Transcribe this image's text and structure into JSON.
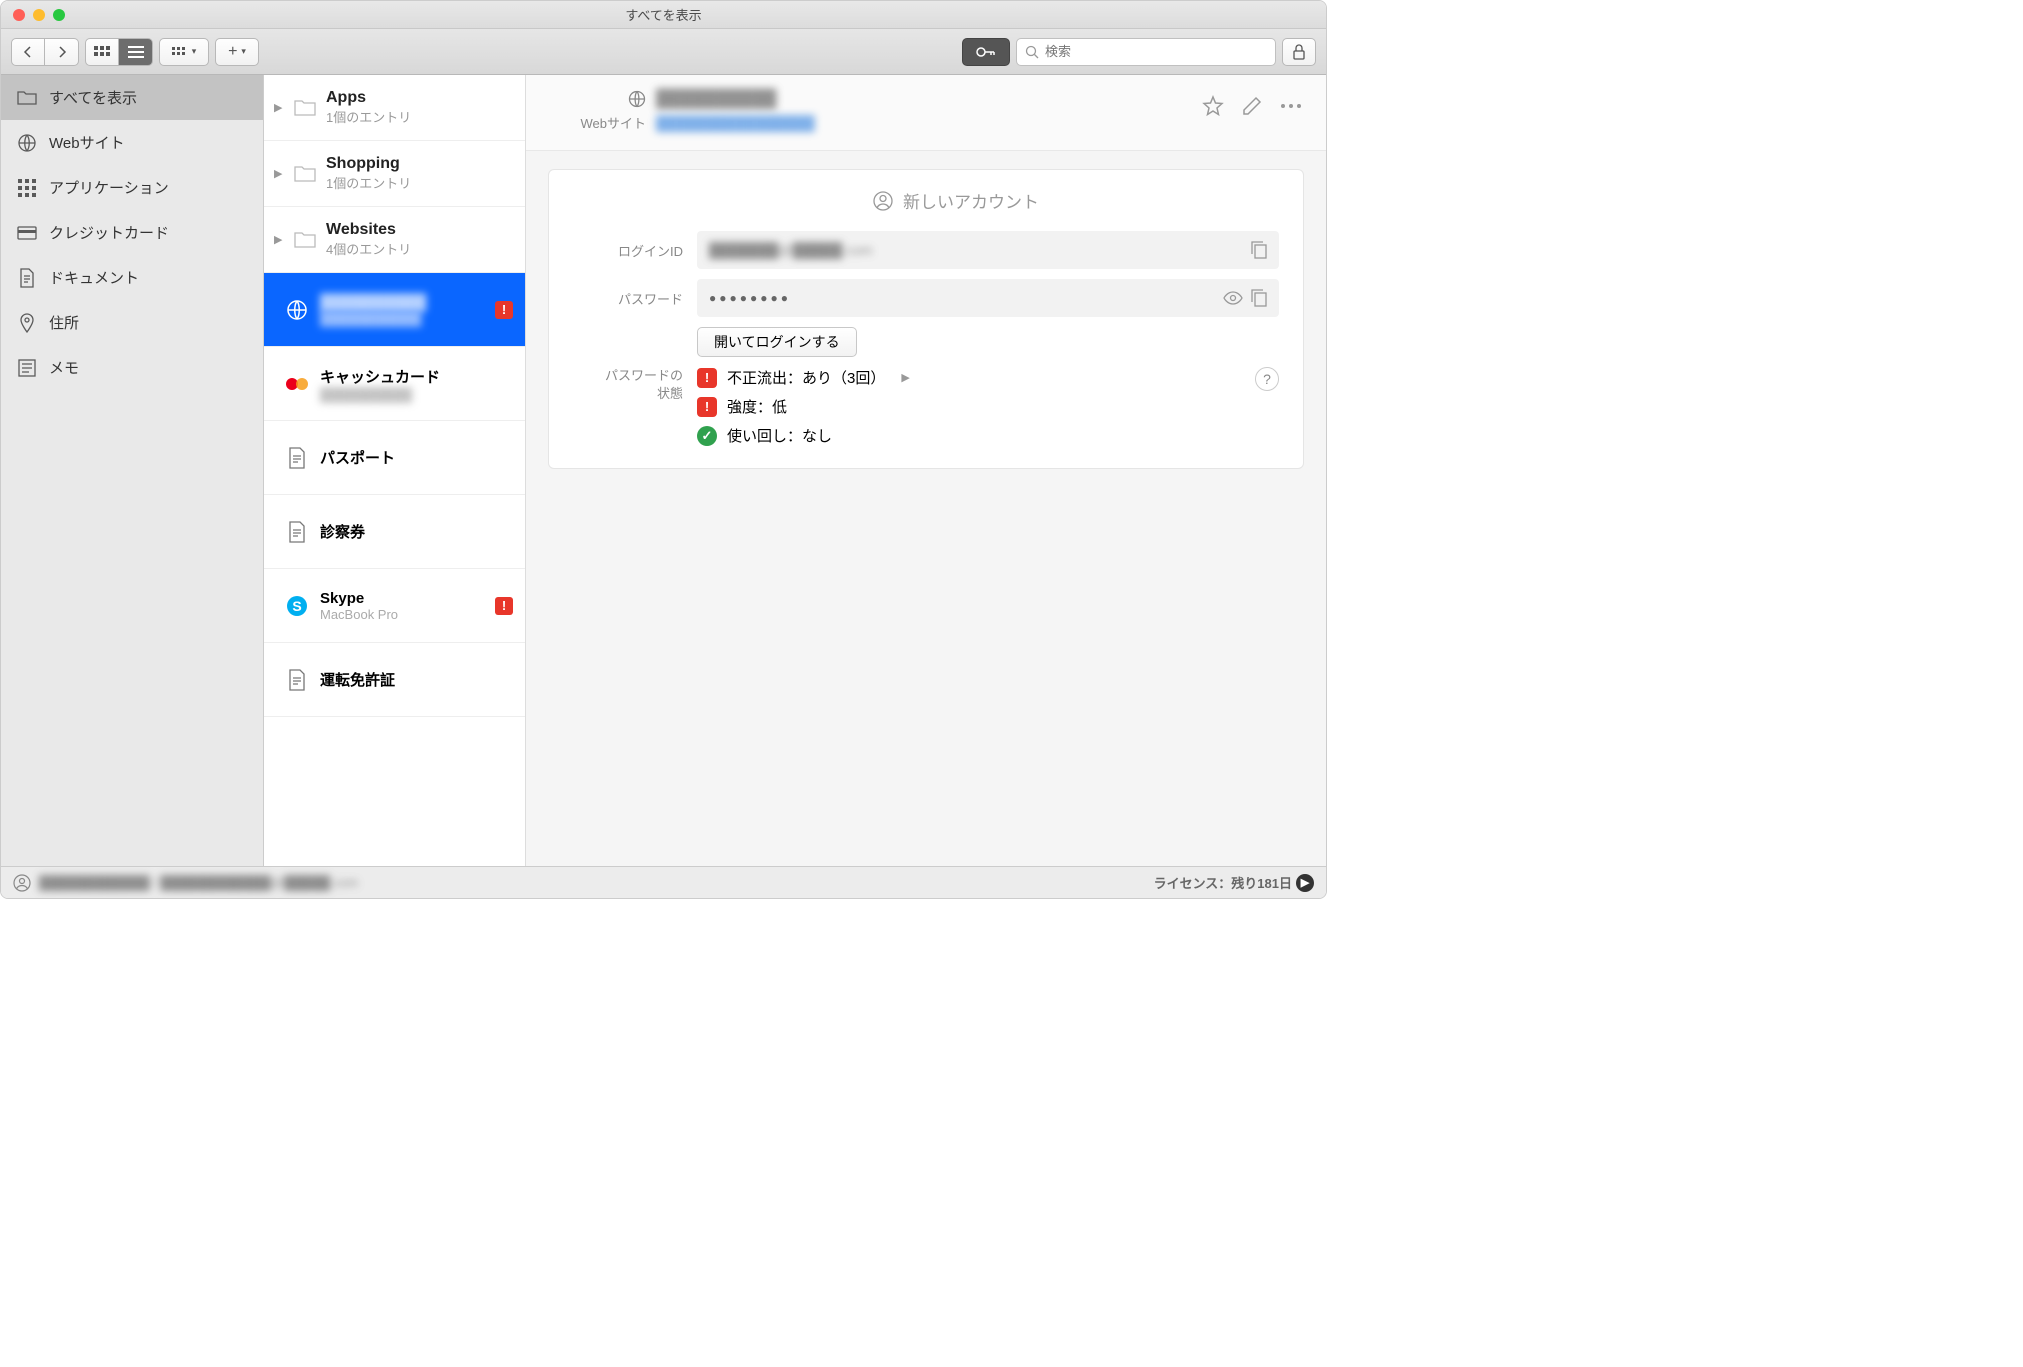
{
  "window": {
    "title": "すべてを表示"
  },
  "toolbar": {
    "search_placeholder": "検索"
  },
  "sidebar": {
    "items": [
      {
        "label": "すべてを表示",
        "icon": "folder",
        "selected": true
      },
      {
        "label": "Webサイト",
        "icon": "globe"
      },
      {
        "label": "アプリケーション",
        "icon": "apps"
      },
      {
        "label": "クレジットカード",
        "icon": "card"
      },
      {
        "label": "ドキュメント",
        "icon": "document"
      },
      {
        "label": "住所",
        "icon": "pin"
      },
      {
        "label": "メモ",
        "icon": "note"
      }
    ]
  },
  "folders": [
    {
      "name": "Apps",
      "subtitle": "1個のエントリ"
    },
    {
      "name": "Shopping",
      "subtitle": "1個のエントリ"
    },
    {
      "name": "Websites",
      "subtitle": "4個のエントリ"
    }
  ],
  "entries": [
    {
      "title": "██████████",
      "subtitle": "███████████",
      "icon": "globe",
      "selected": true,
      "warn": true,
      "blur": true
    },
    {
      "title": "キャッシュカード",
      "subtitle": "██████████",
      "icon": "mastercard",
      "blur_sub": true
    },
    {
      "title": "パスポート",
      "icon": "document"
    },
    {
      "title": "診察券",
      "icon": "document"
    },
    {
      "title": "Skype",
      "subtitle": "MacBook Pro",
      "icon": "skype",
      "warn": true
    },
    {
      "title": "運転免許証",
      "icon": "document"
    }
  ],
  "detail": {
    "header_title": "██████████",
    "header_url": "████████████████",
    "header_label": "Webサイト",
    "section_title": "新しいアカウント",
    "login_label": "ログインID",
    "login_value": "███████@█████.com",
    "password_label": "パスワード",
    "password_value": "●●●●●●●●",
    "open_login_btn": "開いてログインする",
    "pw_status_label_1": "パスワードの",
    "pw_status_label_2": "状態",
    "status": [
      {
        "type": "danger",
        "text": "不正流出：あり（3回）",
        "has_more": true
      },
      {
        "type": "danger",
        "text": "強度：低"
      },
      {
        "type": "ok",
        "text": "使い回し：なし"
      }
    ]
  },
  "statusbar": {
    "account": "████████████ / ████████████@█████.com",
    "license": "ライセンス：残り181日"
  }
}
